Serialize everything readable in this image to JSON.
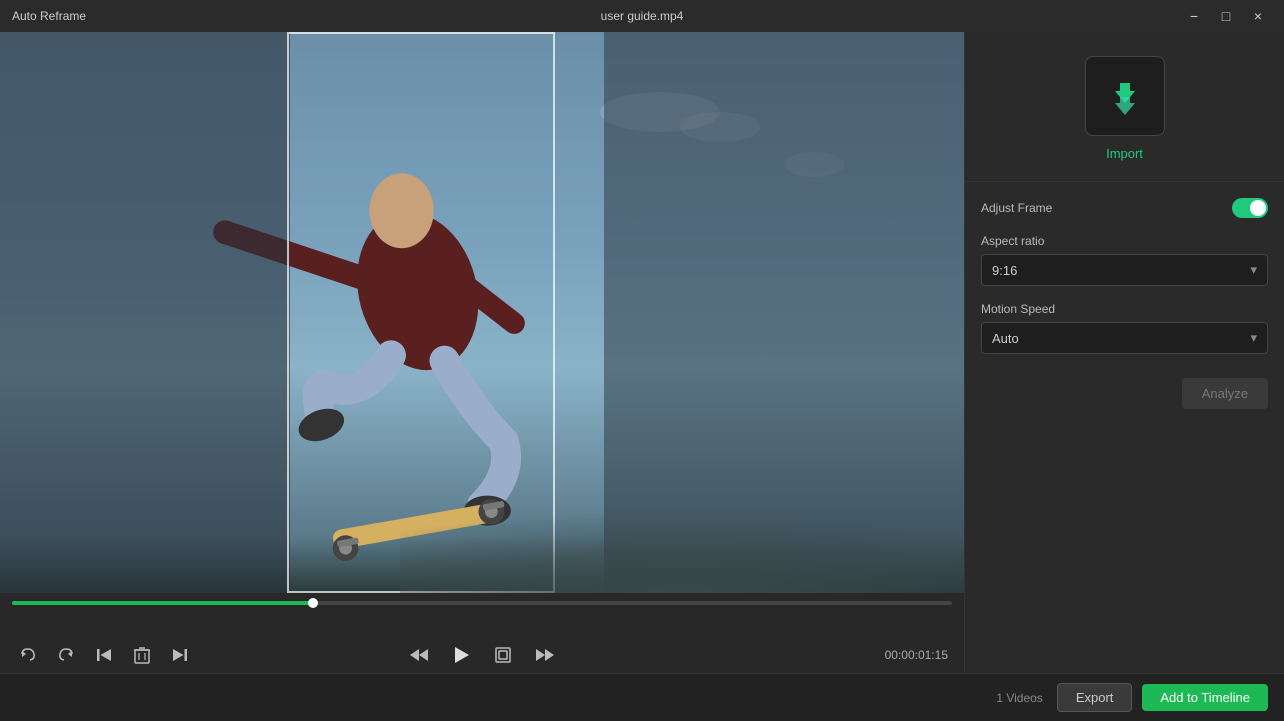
{
  "titlebar": {
    "app_name": "Auto Reframe",
    "file_name": "user guide.mp4",
    "minimize": "−",
    "maximize": "□",
    "close": "×"
  },
  "video": {
    "progress_percent": 32,
    "time_display": "00:00:01:15"
  },
  "controls": {
    "undo": "↩",
    "redo": "↪",
    "skip_back": "⏮",
    "delete": "🗑",
    "skip_fwd": "⏭",
    "step_back": "⏴",
    "play": "▶",
    "fit": "⛶",
    "step_fwd": "⏵"
  },
  "right_panel": {
    "import_label": "Import",
    "adjust_frame_label": "Adjust Frame",
    "aspect_ratio_label": "Aspect ratio",
    "aspect_ratio_value": "9:16",
    "motion_speed_label": "Motion Speed",
    "motion_speed_value": "Auto",
    "analyze_label": "Analyze"
  },
  "bottom_bar": {
    "videos_count": "1 Videos",
    "export_label": "Export",
    "add_timeline_label": "Add to Timeline"
  }
}
